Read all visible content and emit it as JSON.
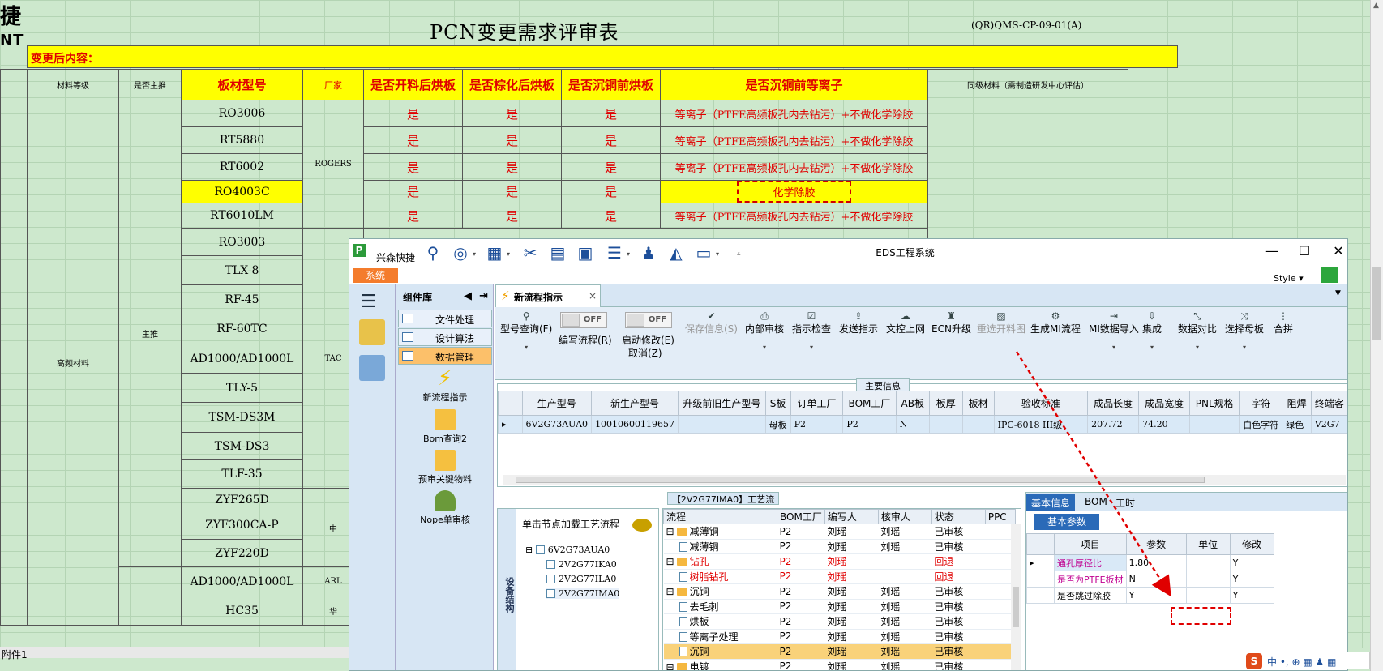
{
  "sheet": {
    "logo_text": "捷",
    "logo_sub": "NT",
    "title": "PCN变更需求评审表",
    "doc_code": "(QR)QMS-CP-09-01(A)",
    "section_label": "变更后内容：",
    "headers": {
      "material_grade": "材料等级",
      "is_main": "是否主推",
      "board_type": "板材型号",
      "manufacturer": "厂家",
      "bake_after_cut": "是否开料后烘板",
      "bake_after_brown": "是否棕化后烘板",
      "bake_before_pth": "是否沉铜前烘板",
      "plasma_before_pth": "是否沉铜前等离子",
      "same_grade": "同级材料（需制造研发中心评估）"
    },
    "group_label": "高频材料",
    "main_label": "主推",
    "rows": [
      {
        "type": "RO3006",
        "mfr": "ROGERS",
        "a": "是",
        "b": "是",
        "c": "是",
        "d": "等离子（PTFE高频板孔内去钻污）+不做化学除胶"
      },
      {
        "type": "RT5880",
        "a": "是",
        "b": "是",
        "c": "是",
        "d": "等离子（PTFE高频板孔内去钻污）+不做化学除胶"
      },
      {
        "type": "RT6002",
        "a": "是",
        "b": "是",
        "c": "是",
        "d": "等离子（PTFE高频板孔内去钻污）+不做化学除胶"
      },
      {
        "type": "RO4003C",
        "a": "是",
        "b": "是",
        "c": "是",
        "d": "化学除胶"
      },
      {
        "type": "RT6010LM",
        "a": "是",
        "b": "是",
        "c": "是",
        "d": "等离子（PTFE高频板孔内去钻污）+不做化学除胶"
      },
      {
        "type": "RO3003"
      },
      {
        "type": "TLX-8"
      },
      {
        "type": "RF-45"
      },
      {
        "type": "RF-60TC"
      },
      {
        "type": "AD1000/AD1000L"
      },
      {
        "type": "TLY-5"
      },
      {
        "type": "TSM-DS3M"
      },
      {
        "type": "TSM-DS3"
      },
      {
        "type": "TLF-35"
      },
      {
        "type": "ZYF265D"
      },
      {
        "type": "ZYF300CA-P"
      },
      {
        "type": "ZYF220D"
      },
      {
        "type": "AD1000/AD1000L"
      },
      {
        "type": "HC35"
      }
    ],
    "mfr_taconic": "TAC",
    "mfr_zhong": "中",
    "mfr_arl": "ARL",
    "mfr_hua": "华",
    "tab_name": "附件1"
  },
  "eds": {
    "app_name": "兴森快捷",
    "window_title": "EDS工程系统",
    "system_tab": "系统",
    "style_label": "Style",
    "comp_lib_title": "组件库",
    "menu": [
      "文件处理",
      "设计算法",
      "数据管理"
    ],
    "functions": [
      "新流程指示",
      "Bom查询2",
      "预审关键物料",
      "Nope单审核"
    ],
    "doc_tab": "新流程指示",
    "ribbon": {
      "model_query": "型号查询(F)",
      "write_flow": "编写流程(R)",
      "start_edit": "启动修改(E)",
      "cancel": "取消(Z)",
      "toggle_off": "OFF",
      "buttons": [
        "保存信息(S)",
        "内部审核",
        "指示检查",
        "发送指示",
        "文控上网",
        "ECN升级",
        "重选开料图",
        "生成MI流程",
        "MI数据导入",
        "集成",
        "数据对比",
        "选择母板",
        "合拼"
      ]
    },
    "main_info_caption": "主要信息",
    "grid_headers": [
      "生产型号",
      "新生产型号",
      "升级前旧生产型号",
      "S板",
      "订单工厂",
      "BOM工厂",
      "AB板",
      "板厚",
      "板材",
      "验收标准",
      "成品长度",
      "成品宽度",
      "PNL规格",
      "字符",
      "阻焊",
      "终端客"
    ],
    "grid_row": [
      "6V2G73AUA0",
      "10010600119657",
      "",
      "母板",
      "P2",
      "P2",
      "N",
      "",
      "",
      "IPC-6018 III级",
      "207.72",
      "74.20",
      "",
      "白色字符",
      "绿色",
      "V2G7"
    ],
    "process_caption": "【2V2G77IMA0】工艺流程",
    "tree_side_label": "设备结构",
    "tree_header": "单击节点加载工艺流程",
    "tree_nodes": [
      "6V2G73AUA0",
      "2V2G77IKA0",
      "2V2G77ILA0",
      "2V2G77IMA0"
    ],
    "flow_headers": [
      "流程",
      "BOM工厂",
      "编写人",
      "核审人",
      "状态",
      "PPC"
    ],
    "flow_rows": [
      {
        "kind": "folder",
        "name": "减薄铜",
        "bom": "P2",
        "writer": "刘瑶",
        "checker": "刘瑶",
        "status": "已审核"
      },
      {
        "kind": "doc",
        "name": "减薄铜",
        "bom": "P2",
        "writer": "刘瑶",
        "checker": "刘瑶",
        "status": "已审核"
      },
      {
        "kind": "folder",
        "name": "钻孔",
        "bom": "P2",
        "writer": "刘瑶",
        "checker": "",
        "status": "回退",
        "reject": true
      },
      {
        "kind": "doc",
        "name": "树脂钻孔",
        "bom": "P2",
        "writer": "刘瑶",
        "checker": "",
        "status": "回退",
        "reject": true
      },
      {
        "kind": "folder",
        "name": "沉铜",
        "bom": "P2",
        "writer": "刘瑶",
        "checker": "刘瑶",
        "status": "已审核"
      },
      {
        "kind": "doc",
        "name": "去毛刺",
        "bom": "P2",
        "writer": "刘瑶",
        "checker": "刘瑶",
        "status": "已审核"
      },
      {
        "kind": "doc",
        "name": "烘板",
        "bom": "P2",
        "writer": "刘瑶",
        "checker": "刘瑶",
        "status": "已审核"
      },
      {
        "kind": "doc",
        "name": "等离子处理",
        "bom": "P2",
        "writer": "刘瑶",
        "checker": "刘瑶",
        "status": "已审核"
      },
      {
        "kind": "doc",
        "name": "沉铜",
        "bom": "P2",
        "writer": "刘瑶",
        "checker": "刘瑶",
        "status": "已审核",
        "selected": true
      },
      {
        "kind": "folder",
        "name": "电镀",
        "bom": "P2",
        "writer": "刘瑶",
        "checker": "刘瑶",
        "status": "已审核"
      }
    ],
    "right_tabs": [
      "基本信息",
      "BOM",
      "工时"
    ],
    "basic_param_tab": "基本参数",
    "param_headers": [
      "项目",
      "参数",
      "单位",
      "修改"
    ],
    "params": [
      {
        "item": "通孔厚径比",
        "value": "1.80",
        "unit": "",
        "edit": "Y"
      },
      {
        "item": "是否为PTFE板材",
        "value": "N",
        "unit": "",
        "edit": "Y"
      },
      {
        "item": "是否跳过除胶",
        "value": "Y",
        "unit": "",
        "edit": "Y"
      }
    ],
    "ime_text": "中 •, ⊕ ▦ ♟ ▦"
  },
  "colors": {
    "sheet_bg": "#cde8cd",
    "highlight_yellow": "#ffff00",
    "alert_red": "#e00000",
    "accent_orange": "#f47c2c",
    "accent_blue": "#2a6ab8"
  }
}
